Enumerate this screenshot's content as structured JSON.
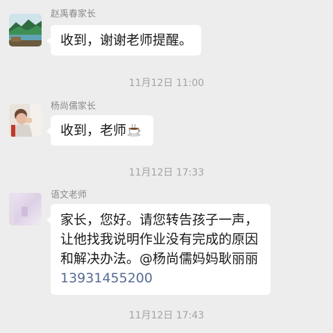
{
  "messages": [
    {
      "sender": "赵禹春家长",
      "avatar_icon": "lake-landscape-avatar",
      "lines": [
        "收到，谢谢老师提醒。"
      ]
    },
    {
      "sender": "杨尚儒家长",
      "avatar_icon": "child-photo-avatar",
      "lines": [
        "收到，老师"
      ],
      "emoji": "hot-beverage-emoji"
    },
    {
      "sender": "语文老师",
      "avatar_icon": "pastel-blur-avatar",
      "lines": [
        "家长，您好。请您转告孩子一声，",
        "让他找我说明作业没有完成的原因",
        "和解决办法。@杨尚儒妈妈耿丽丽"
      ],
      "phone": "13931455200"
    }
  ],
  "timestamps": [
    "11月12日 11:00",
    "11月12日 17:33",
    "11月12日 17:43"
  ],
  "colors": {
    "background": "#ededed",
    "bubble": "#ffffff",
    "link": "#576b95",
    "meta_text": "#a3a3a3"
  }
}
